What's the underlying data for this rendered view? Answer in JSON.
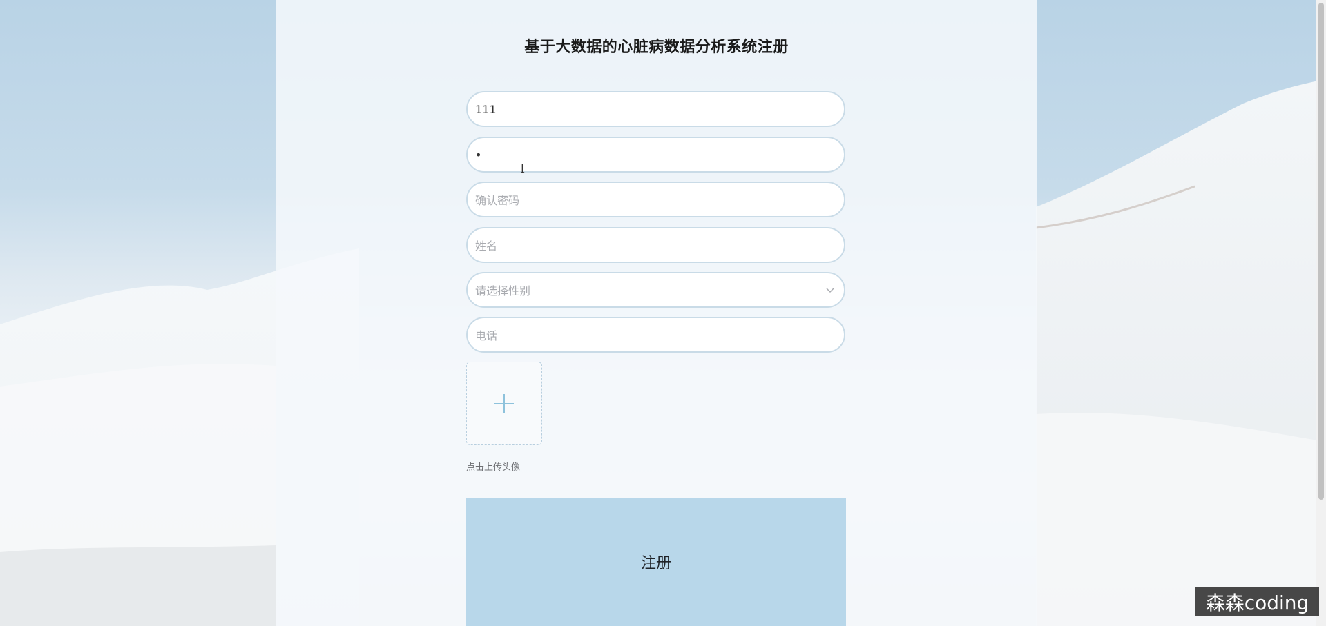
{
  "title": "基于大数据的心脏病数据分析系统注册",
  "form": {
    "username_value": "111",
    "password_value": "•",
    "confirm_password_placeholder": "确认密码",
    "name_placeholder": "姓名",
    "gender_placeholder": "请选择性别",
    "phone_placeholder": "电话",
    "upload_hint": "点击上传头像",
    "register_label": "注册"
  },
  "watermark": "森森coding",
  "icons": {
    "upload": "plus-icon",
    "gender_dropdown": "chevron-down-icon",
    "cursor": "text-cursor-icon"
  },
  "colors": {
    "button_bg": "#b8d7ea",
    "field_border": "#c9dbe7",
    "plus_icon": "#8ec2dc"
  }
}
